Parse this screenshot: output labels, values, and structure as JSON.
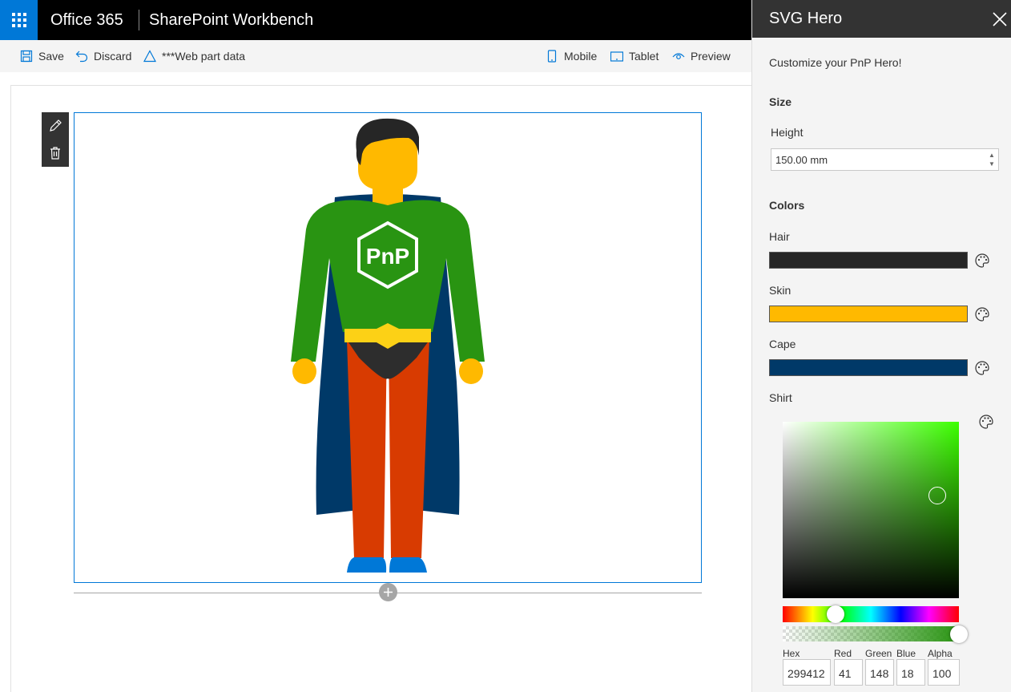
{
  "suite": {
    "brand": "Office 365",
    "app_title": "SharePoint Workbench"
  },
  "commands": {
    "save": "Save",
    "discard": "Discard",
    "web_part_data": "***Web part data",
    "mobile": "Mobile",
    "tablet": "Tablet",
    "preview": "Preview"
  },
  "hero": {
    "badge_text": "PnP",
    "colors": {
      "hair": "#262626",
      "skin": "#ffb900",
      "cape": "#003968",
      "shirt": "#299412",
      "pants": "#d83b01",
      "shoes": "#0078d7",
      "belt": "#fcd116",
      "briefs": "#2d2d2d"
    }
  },
  "pane": {
    "title": "SVG Hero",
    "description": "Customize your PnP Hero!",
    "size_group": "Size",
    "height_label": "Height",
    "height_value": "150.00 mm",
    "colors_group": "Colors",
    "hair_label": "Hair",
    "skin_label": "Skin",
    "cape_label": "Cape",
    "shirt_label": "Shirt",
    "picker": {
      "hue_color": "#3cff00",
      "hue_level": 0.3,
      "alpha_level": 1.0,
      "hex_label": "Hex",
      "hex_value": "299412",
      "red_label": "Red",
      "red_value": "41",
      "green_label": "Green",
      "green_value": "148",
      "blue_label": "Blue",
      "blue_value": "18",
      "alpha_label": "Alpha",
      "alpha_value": "100"
    }
  },
  "icons": [
    "waffle-icon",
    "save-icon",
    "undo-icon",
    "warning-icon",
    "mobile-icon",
    "tablet-icon",
    "eye-icon",
    "edit-icon",
    "delete-icon",
    "add-icon",
    "close-icon",
    "palette-icon"
  ]
}
